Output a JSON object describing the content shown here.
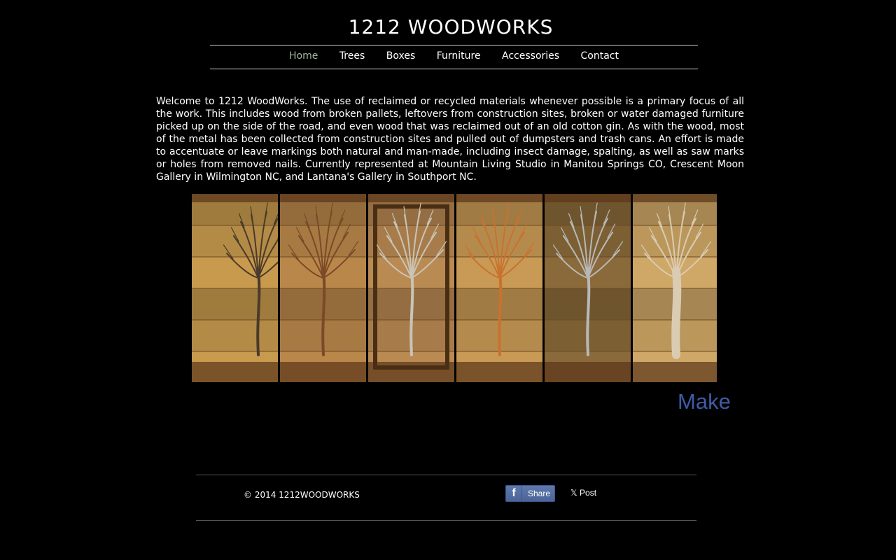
{
  "site": {
    "title": "1212 WOODWORKS"
  },
  "nav": {
    "items": [
      {
        "label": "Home"
      },
      {
        "label": "Trees"
      },
      {
        "label": "Boxes"
      },
      {
        "label": "Furniture"
      },
      {
        "label": "Accessories"
      },
      {
        "label": "Contact"
      }
    ],
    "active": "Home"
  },
  "intro": {
    "text": "Welcome to 1212 WoodWorks. The use of reclaimed or recycled materials whenever possible is a primary focus of all the work. This includes wood from broken pallets, leftovers from construction sites, broken or water damaged furniture picked up on the side of the road, and even wood that was reclaimed out of an old cotton gin. As with the wood, most of the metal has been collected from construction sites and pulled out of dumpsters and trash cans. An effort is made to accentuate or leave markings both natural and man-made, including insect damage, spalting, as well as saw marks or holes from removed nails. Currently represented at Mountain Living Studio in Manitou Springs CO, Crescent Moon Gallery in Wilmington NC, and Lantana's Gallery in Southport NC."
  },
  "gallery": {
    "panels": [
      {
        "name": "tree-panel-1",
        "wood": "#c89a4e",
        "metal": "#4a3a2a"
      },
      {
        "name": "tree-panel-2",
        "wood": "#b9874a",
        "metal": "#7a4a28"
      },
      {
        "name": "tree-panel-3",
        "wood": "#b98a52",
        "metal": "#c9c4b8"
      },
      {
        "name": "tree-panel-4",
        "wood": "#c99a55",
        "metal": "#c8722e"
      },
      {
        "name": "tree-panel-5",
        "wood": "#8a6a3a",
        "metal": "#b8b8b8"
      },
      {
        "name": "tree-panel-6",
        "wood": "#cfa766",
        "metal": "#d9ccb2"
      }
    ]
  },
  "make_link": {
    "label": "Make"
  },
  "footer": {
    "copyright": "© 2014 1212WOODWORKS",
    "share_label": "Share",
    "share_icon": "facebook-icon",
    "post_label": "Post",
    "post_icon": "x-icon"
  },
  "colors": {
    "background": "#000000",
    "nav_active": "#9fb89c",
    "make_link": "#3f5ba6",
    "facebook": "#4c6598"
  }
}
